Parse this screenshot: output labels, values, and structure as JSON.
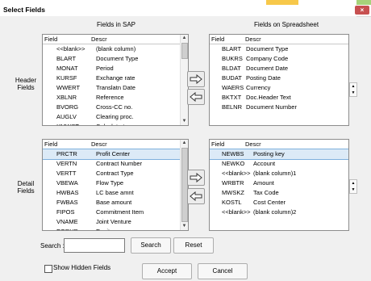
{
  "window": {
    "title": "Select Fields",
    "close_glyph": "×"
  },
  "headers": {
    "fields_in_sap": "Fields in SAP",
    "fields_on_spreadsheet": "Fields on Spreadsheet"
  },
  "side_labels": {
    "header_fields": "Header\nFields",
    "detail_fields": "Detail\nFields"
  },
  "columns": {
    "field": "Field",
    "descr": "Descr"
  },
  "header_sap": [
    {
      "field": "<<blank>>",
      "descr": "(blank column)"
    },
    {
      "field": "BLART",
      "descr": "Document Type"
    },
    {
      "field": "MONAT",
      "descr": "Period"
    },
    {
      "field": "KURSF",
      "descr": "Exchange rate"
    },
    {
      "field": "WWERT",
      "descr": "Translatn Date"
    },
    {
      "field": "XBLNR",
      "descr": "Reference"
    },
    {
      "field": "BVORG",
      "descr": "Cross-CC no."
    },
    {
      "field": "AUGLV",
      "descr": "Clearing proc."
    },
    {
      "field": "XMWST",
      "descr": "Calculate tax"
    }
  ],
  "header_sheet": [
    {
      "field": "BLART",
      "descr": "Document Type"
    },
    {
      "field": "BUKRS",
      "descr": "Company Code"
    },
    {
      "field": "BLDAT",
      "descr": "Document Date"
    },
    {
      "field": "BUDAT",
      "descr": "Posting Date"
    },
    {
      "field": "WAERS",
      "descr": "Currency"
    },
    {
      "field": "BKTXT",
      "descr": "Doc.Header Text"
    },
    {
      "field": "BELNR",
      "descr": "Document Number"
    }
  ],
  "detail_sap": [
    {
      "field": "PRCTR",
      "descr": "Profit Center",
      "selected": true
    },
    {
      "field": "VERTN",
      "descr": "Contract Number"
    },
    {
      "field": "VERTT",
      "descr": "Contract Type"
    },
    {
      "field": "VBEWA",
      "descr": "Flow Type"
    },
    {
      "field": "HWBAS",
      "descr": "LC base amnt"
    },
    {
      "field": "FWBAS",
      "descr": "Base amount"
    },
    {
      "field": "FIPOS",
      "descr": "Commitment Item"
    },
    {
      "field": "VNAME",
      "descr": "Joint Venture"
    },
    {
      "field": "EGRUP",
      "descr": "Equity group"
    }
  ],
  "detail_sheet": [
    {
      "field": "NEWBS",
      "descr": "Posting key",
      "selected": true
    },
    {
      "field": "NEWKO",
      "descr": "Account"
    },
    {
      "field": "<<blank>>",
      "descr": "(blank column)1"
    },
    {
      "field": "WRBTR",
      "descr": "Amount"
    },
    {
      "field": "MWSKZ",
      "descr": "Tax Code"
    },
    {
      "field": "KOSTL",
      "descr": "Cost Center"
    },
    {
      "field": "<<blank>>",
      "descr": "(blank column)2"
    }
  ],
  "search": {
    "label": "Search :",
    "value": "",
    "search_button": "Search",
    "reset_button": "Reset"
  },
  "footer": {
    "show_hidden": "Show Hidden Fields",
    "show_hidden_checked": false,
    "accept": "Accept",
    "cancel": "Cancel"
  },
  "colors": {
    "close_red": "#c75050",
    "selection": "#dceaf7",
    "green_strip": "#a6d37a",
    "accent_yellow": "#f7c84a"
  }
}
